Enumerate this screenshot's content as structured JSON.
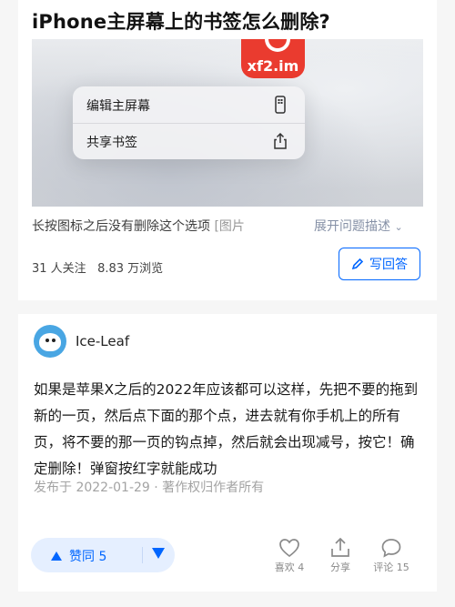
{
  "question": {
    "title": "iPhone主屏幕上的书签怎么删除?",
    "image": {
      "app_icon_text": "xf2.im",
      "context_menu": [
        {
          "label": "编辑主屏幕",
          "icon": "phone-icon"
        },
        {
          "label": "共享书签",
          "icon": "share-icon"
        }
      ]
    },
    "description": "长按图标之后没有删除这个选项",
    "description_tail": "[图片",
    "expand_label": "展开问题描述",
    "stats": "31 人关注   8.83 万浏览",
    "write_answer_label": "写回答"
  },
  "answer": {
    "author": "Ice-Leaf",
    "content": "如果是苹果X之后的2022年应该都可以这样，先把不要的拖到新的一页，然后点下面的那个点，进去就有你手机上的所有页，将不要的那一页的钩点掉，然后就会出现减号，按它！确定删除！弹窗按红字就能成功",
    "meta": "发布于 2022-01-29 · 著作权归作者所有",
    "vote_up_label": "赞同 5",
    "actions": [
      {
        "label": "喜欢 4",
        "icon": "heart-icon"
      },
      {
        "label": "分享",
        "icon": "share-icon"
      },
      {
        "label": "评论 15",
        "icon": "comment-icon"
      }
    ]
  },
  "colors": {
    "accent": "#0066ff",
    "brand_red": "#ea3b2f",
    "avatar": "#49a6e3"
  }
}
